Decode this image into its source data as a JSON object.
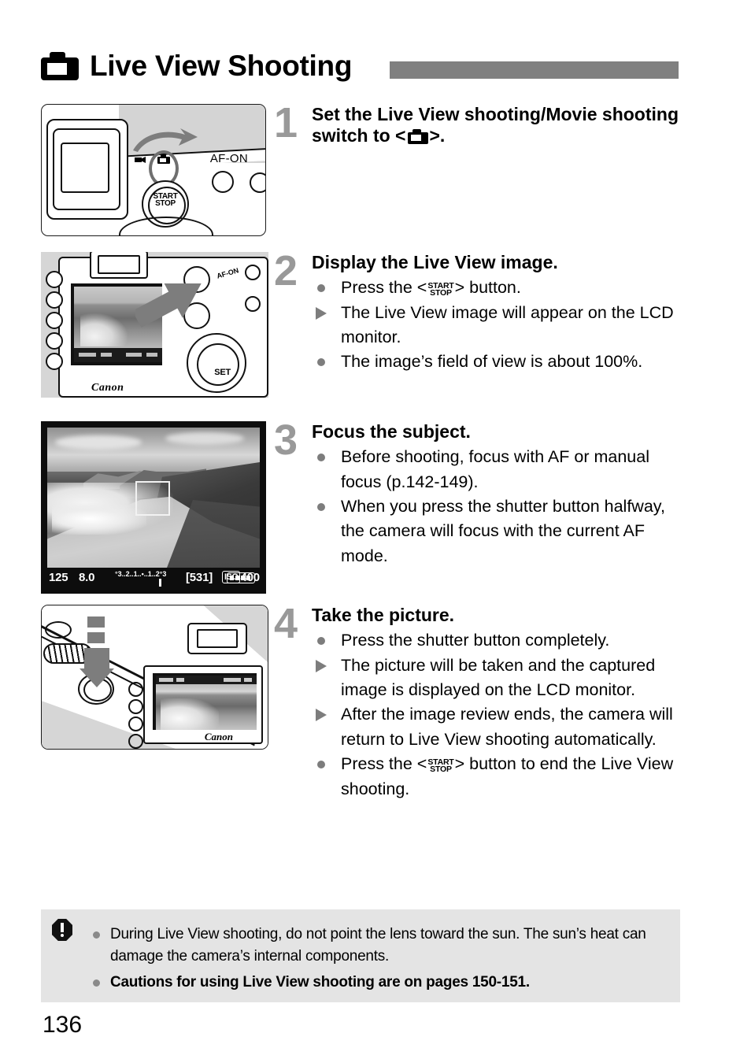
{
  "page": {
    "number": "136",
    "title": "Live View Shooting",
    "title_icon": "camera-icon"
  },
  "steps": [
    {
      "number": "1",
      "title_pre": "Set the Live View shooting/Movie shooting switch to <",
      "title_icon": "camera-icon",
      "title_post": ">.",
      "bullets": [],
      "figure": {
        "name": "camera-top-switch-illustration",
        "labels": {
          "af_on": "AF-ON",
          "start": "START",
          "stop": "STOP"
        }
      }
    },
    {
      "number": "2",
      "title": "Display the Live View image.",
      "bullets": [
        {
          "marker": "dot",
          "pre": "Press the <",
          "glyph": "start-stop-button-icon",
          "post": "> button."
        },
        {
          "marker": "tri",
          "text": "The Live View image will appear on the LCD monitor."
        },
        {
          "marker": "dot",
          "text": "The image’s field of view is about 100%."
        }
      ],
      "figure": {
        "name": "camera-back-press-start-stop-illustration",
        "labels": {
          "brand": "Canon",
          "set": "SET",
          "af_on": "AF-ON"
        }
      }
    },
    {
      "number": "3",
      "title": "Focus the subject.",
      "bullets": [
        {
          "marker": "dot",
          "text": "Before shooting, focus with AF or manual focus (p.142-149)."
        },
        {
          "marker": "dot",
          "text": "When you press the shutter button halfway, the camera will focus with the current AF mode."
        }
      ],
      "figure": {
        "name": "live-view-lcd-screen",
        "readout": {
          "shutter_speed": "125",
          "aperture": "8.0",
          "exposure_scale": "°3..2..1..•..1..2°3",
          "shots_remaining": "[531]",
          "iso_label": "ISO",
          "iso_value": "400",
          "battery": "battery-full-icon"
        }
      }
    },
    {
      "number": "4",
      "title": "Take the picture.",
      "bullets": [
        {
          "marker": "dot",
          "text": "Press the shutter button completely."
        },
        {
          "marker": "tri",
          "text": "The picture will be taken and the captured image is displayed on the LCD monitor."
        },
        {
          "marker": "tri",
          "text": "After the image review ends, the camera will return to Live View shooting automatically."
        },
        {
          "marker": "dot",
          "pre": "Press the <",
          "glyph": "start-stop-button-icon",
          "post": "> button to end the Live View shooting."
        }
      ],
      "figure": {
        "name": "press-shutter-button-illustration",
        "labels": {
          "brand": "Canon"
        }
      }
    }
  ],
  "caution": {
    "icon": "warning-octagon-icon",
    "items": [
      {
        "text": "During Live View shooting, do not point the lens toward the sun. The sun’s heat can damage the camera’s internal components.",
        "bold": false
      },
      {
        "text": "Cautions for using Live View shooting are on pages 150-151.",
        "bold": true
      }
    ]
  },
  "colors": {
    "header_bar": "#808080",
    "step_number": "#999999",
    "marker": "#7d7d7d",
    "caution_bg": "#e4e4e4"
  },
  "glyphs": {
    "start": "START",
    "stop": "STOP"
  }
}
